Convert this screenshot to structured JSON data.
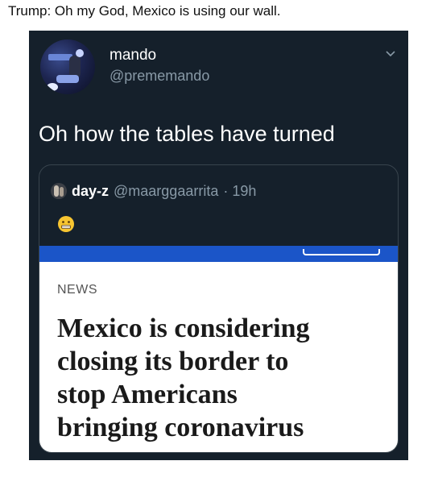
{
  "caption": "Trump: Oh my God, Mexico is using our wall.",
  "tweet": {
    "display_name": "mando",
    "handle": "@prememando",
    "text": "Oh how the tables have turned",
    "icons": {
      "avatar": "profile-photo",
      "menu": "chevron-down-icon"
    }
  },
  "quote": {
    "name": "day-z",
    "handle": "@maarggaarrita",
    "time": "· 19h",
    "emoji": "grimacing-face-emoji",
    "article": {
      "label": "NEWS",
      "headline_lines": [
        "Mexico is considering",
        "closing its border to",
        "stop Americans",
        "bringing coronavirus"
      ]
    }
  },
  "colors": {
    "card_bg": "#15202b",
    "secondary_text": "#8899a6",
    "strip_blue": "#1b55c8",
    "border": "#38444d"
  }
}
